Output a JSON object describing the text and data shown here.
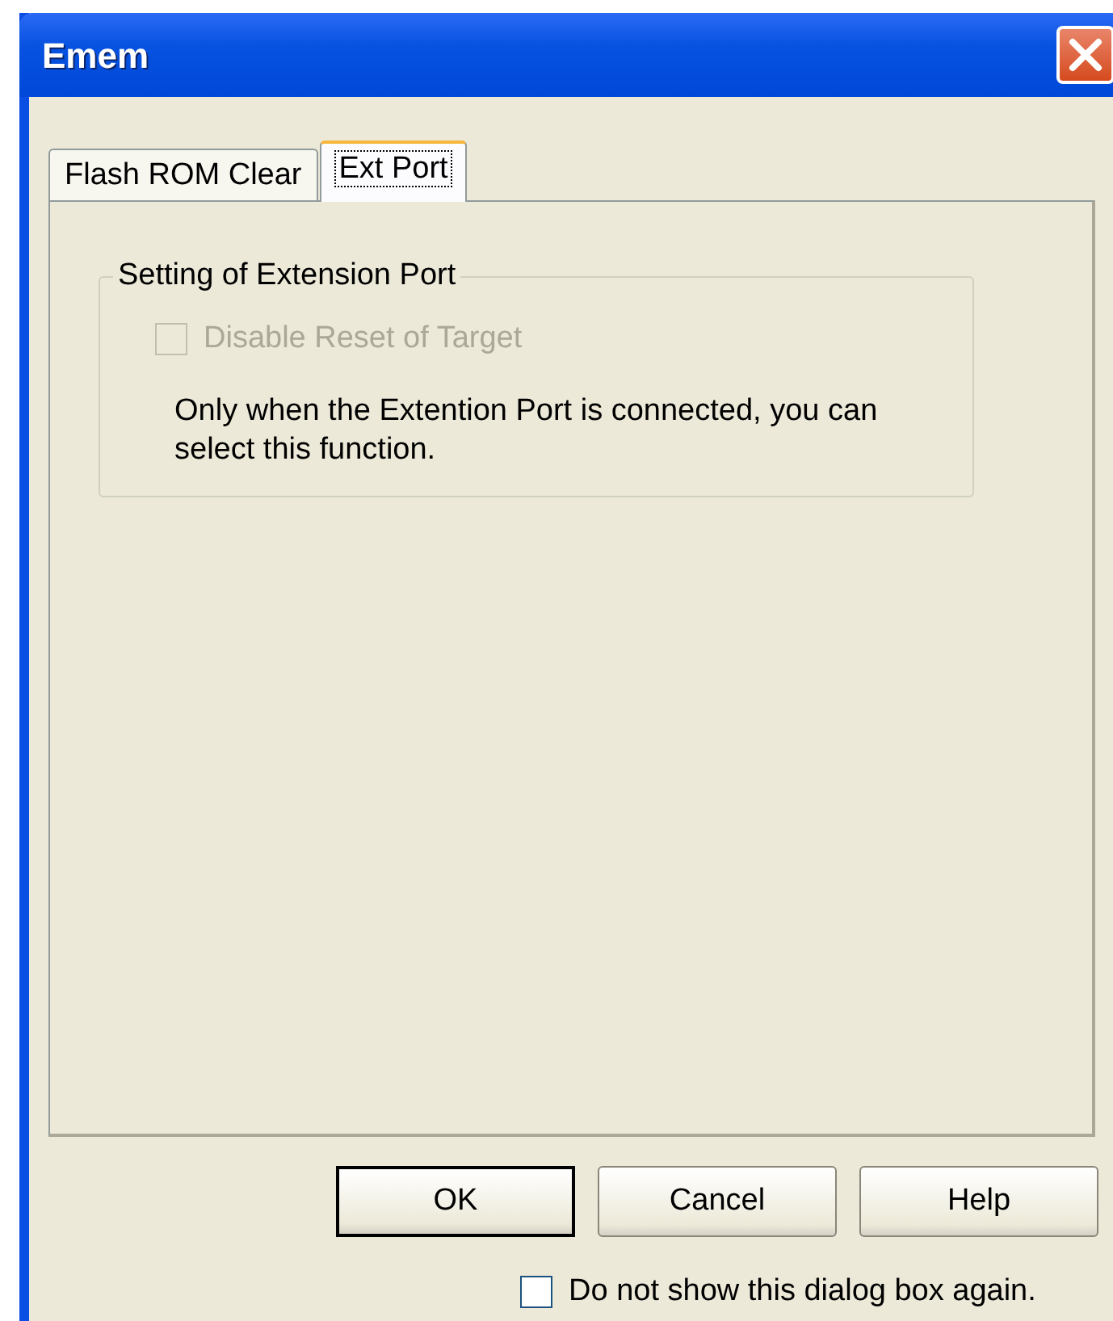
{
  "window": {
    "title": "Emem"
  },
  "tabs": [
    {
      "label": "Flash ROM Clear",
      "selected": false
    },
    {
      "label": "Ext Port",
      "selected": true
    }
  ],
  "group": {
    "title": "Setting of Extension Port",
    "checkbox": {
      "label": "Disable Reset of Target",
      "checked": false,
      "disabled": true
    },
    "note": "Only when the Extention Port is connected, you can select this function."
  },
  "buttons": [
    {
      "label": "OK",
      "default": true
    },
    {
      "label": "Cancel",
      "default": false
    },
    {
      "label": "Help",
      "default": false
    }
  ],
  "footer_checkbox": {
    "label": "Do not show this dialog box again.",
    "checked": false,
    "disabled": false
  }
}
